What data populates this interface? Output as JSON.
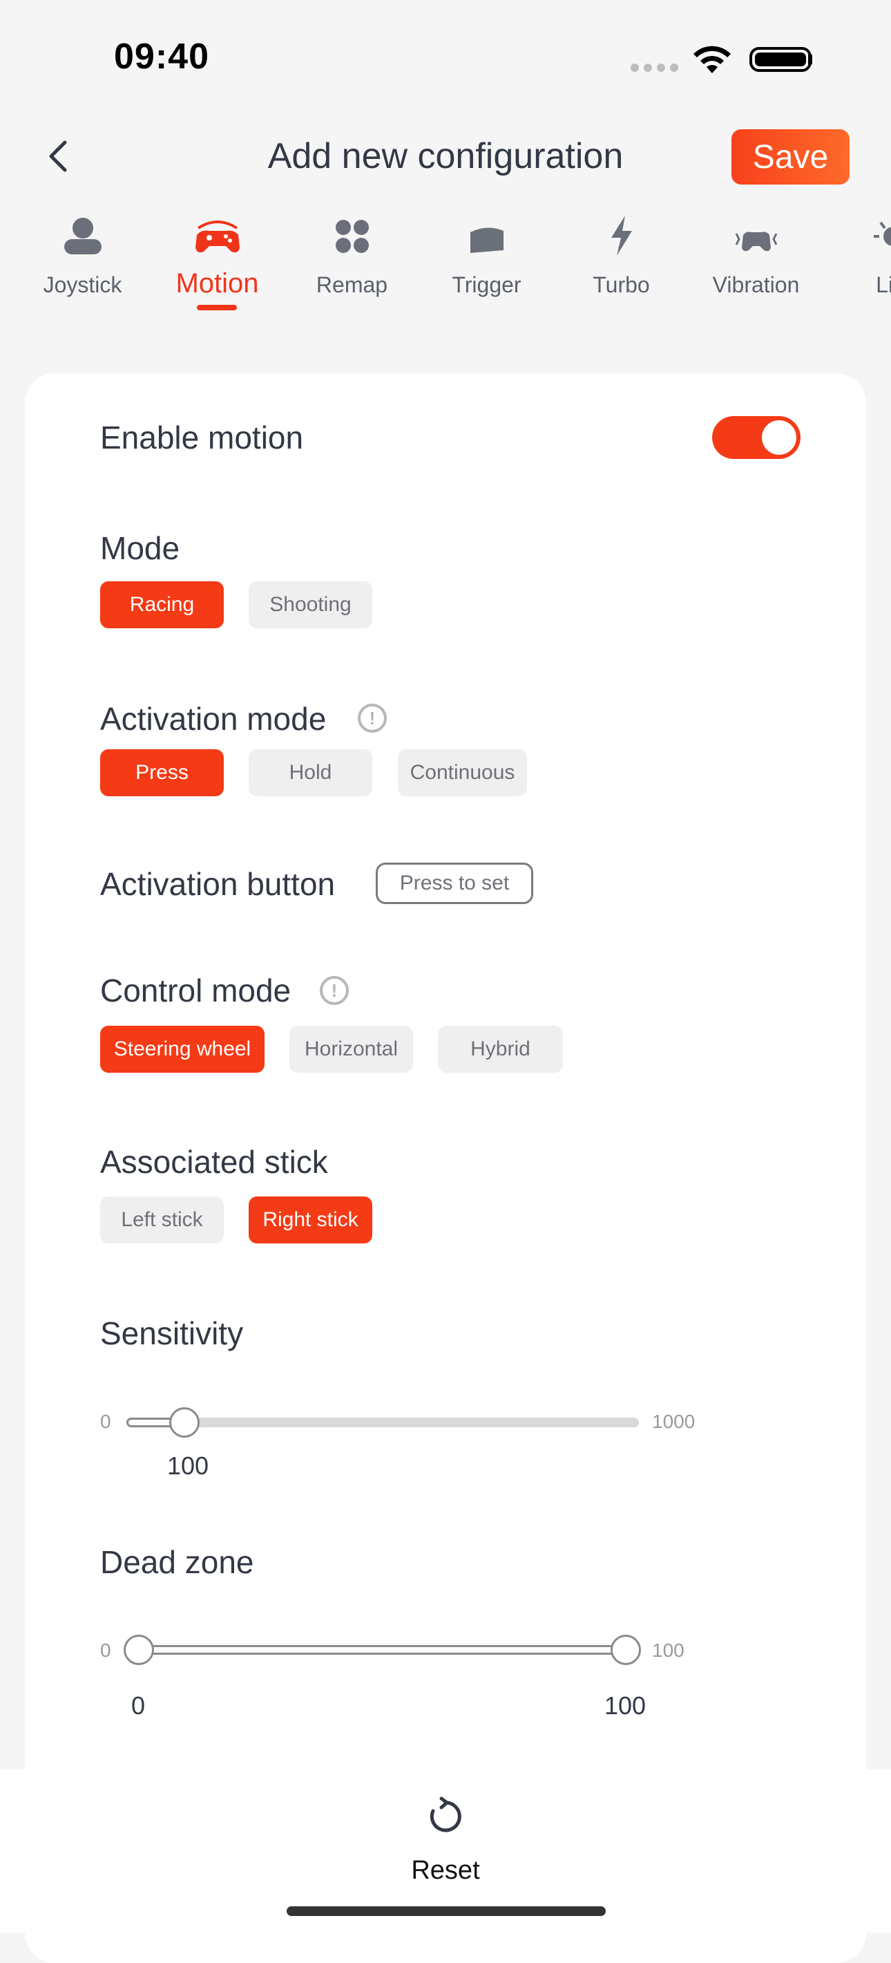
{
  "status_bar": {
    "time": "09:40"
  },
  "header": {
    "title": "Add new configuration",
    "save_label": "Save"
  },
  "tabs": [
    {
      "label": "Joystick",
      "icon": "joystick-icon"
    },
    {
      "label": "Motion",
      "icon": "motion-gamepad-icon",
      "active": true
    },
    {
      "label": "Remap",
      "icon": "remap-dots-icon"
    },
    {
      "label": "Trigger",
      "icon": "trigger-icon"
    },
    {
      "label": "Turbo",
      "icon": "lightning-icon"
    },
    {
      "label": "Vibration",
      "icon": "vibration-icon"
    },
    {
      "label": "Lig",
      "icon": "light-icon"
    }
  ],
  "colors": {
    "accent": "#f53a16",
    "chip_off": "#efefef",
    "text": "#333845"
  },
  "enable_motion": {
    "label": "Enable motion",
    "enabled": true
  },
  "mode": {
    "label": "Mode",
    "options": [
      "Racing",
      "Shooting"
    ],
    "selected": "Racing"
  },
  "activation_mode": {
    "label": "Activation mode",
    "options": [
      "Press",
      "Hold",
      "Continuous"
    ],
    "selected": "Press"
  },
  "activation_button": {
    "label": "Activation button",
    "button_label": "Press to set"
  },
  "control_mode": {
    "label": "Control mode",
    "options": [
      "Steering wheel",
      "Horizontal",
      "Hybrid"
    ],
    "selected": "Steering wheel"
  },
  "associated_stick": {
    "label": "Associated stick",
    "options": [
      "Left stick",
      "Right stick"
    ],
    "selected": "Right stick"
  },
  "sensitivity": {
    "label": "Sensitivity",
    "min": "0",
    "max": "1000",
    "value": "100"
  },
  "dead_zone": {
    "label": "Dead zone",
    "min": "0",
    "max": "100",
    "low_value": "0",
    "high_value": "100"
  },
  "footer": {
    "reset_label": "Reset"
  }
}
